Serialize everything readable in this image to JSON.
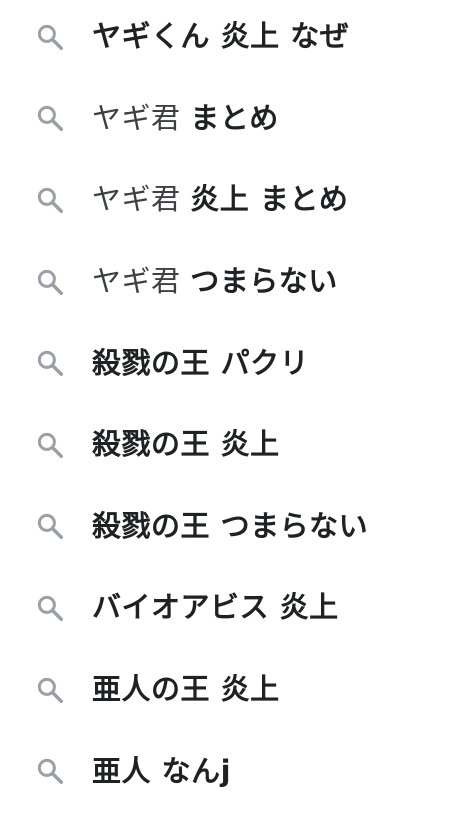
{
  "suggestions": [
    {
      "typed": "",
      "completion": "ヤギくん 炎上 なぜ",
      "icon": "search-icon"
    },
    {
      "typed": "ヤギ君 ",
      "completion": "まとめ",
      "icon": "search-icon"
    },
    {
      "typed": "ヤギ君 ",
      "completion": "炎上 まとめ",
      "icon": "search-icon"
    },
    {
      "typed": "ヤギ君 ",
      "completion": "つまらない",
      "icon": "search-icon"
    },
    {
      "typed": "",
      "completion": "殺戮の王 パクリ",
      "icon": "search-icon"
    },
    {
      "typed": "",
      "completion": "殺戮の王 炎上",
      "icon": "search-icon"
    },
    {
      "typed": "",
      "completion": "殺戮の王 つまらない",
      "icon": "search-icon"
    },
    {
      "typed": "",
      "completion": "バイオアビス 炎上",
      "icon": "search-icon"
    },
    {
      "typed": "",
      "completion": "亜人の王 炎上",
      "icon": "search-icon"
    },
    {
      "typed": "",
      "completion": "亜人 なんj",
      "icon": "search-icon"
    }
  ],
  "colors": {
    "icon": "#9aa0a6",
    "text": "#202124",
    "background": "#ffffff"
  }
}
